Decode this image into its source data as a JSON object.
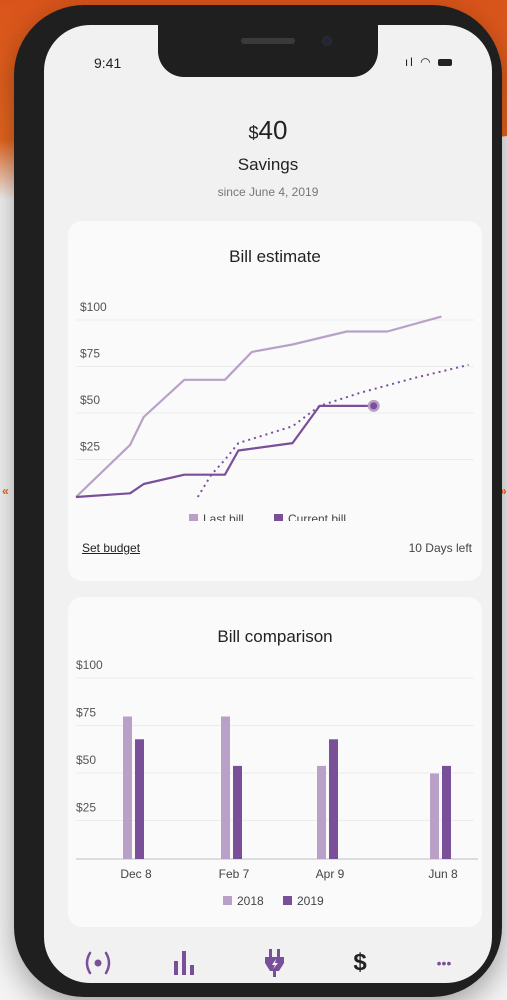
{
  "status": {
    "time": "9:41"
  },
  "summary": {
    "currency": "$",
    "amount": "40",
    "label": "Savings",
    "since": "since June 4, 2019"
  },
  "bill_estimate": {
    "title": "Bill estimate",
    "legend": [
      "Last bill",
      "Current bill"
    ],
    "set_budget": "Set budget",
    "days_left": "10 Days left"
  },
  "bill_comparison": {
    "title": "Bill comparison",
    "legend": [
      "2018",
      "2019"
    ]
  },
  "colors": {
    "light": "#b9a0c9",
    "dark": "#7a4f99",
    "accent": "#e5661f"
  },
  "tabs": [
    {
      "icon": "live-icon"
    },
    {
      "icon": "usage-bars-icon"
    },
    {
      "icon": "plug-icon"
    },
    {
      "icon": "dollar-icon",
      "label": "$"
    },
    {
      "icon": "more-icon",
      "label": "•••"
    }
  ],
  "chart_data": [
    {
      "type": "line",
      "title": "Bill estimate",
      "y_ticks": [
        "$100",
        "$75",
        "$50",
        "$25"
      ],
      "ylim": [
        0,
        100
      ],
      "x": [
        0,
        1,
        2,
        3,
        4,
        5,
        6,
        7,
        8,
        9,
        10,
        11,
        12,
        13,
        14,
        15,
        16,
        17,
        18,
        19,
        20,
        21,
        22,
        23,
        24,
        25,
        26,
        27,
        28,
        29,
        30
      ],
      "series": [
        {
          "name": "Last bill",
          "style": "solid",
          "points": [
            [
              0,
              0
            ],
            [
              4,
              28
            ],
            [
              5,
              43
            ],
            [
              8,
              63
            ],
            [
              11,
              63
            ],
            [
              13,
              78
            ],
            [
              16,
              82
            ],
            [
              20,
              89
            ],
            [
              23,
              89
            ],
            [
              27,
              97
            ]
          ]
        },
        {
          "name": "Current bill",
          "style": "solid",
          "points": [
            [
              0,
              0
            ],
            [
              4,
              2
            ],
            [
              5,
              7
            ],
            [
              8,
              12
            ],
            [
              11,
              12
            ],
            [
              12,
              25
            ],
            [
              16,
              29
            ],
            [
              18,
              49
            ],
            [
              22,
              49
            ]
          ]
        },
        {
          "name": "Projection",
          "style": "dotted",
          "points": [
            [
              9,
              0
            ],
            [
              10,
              12
            ],
            [
              11,
              20
            ],
            [
              12,
              29
            ],
            [
              16,
              38
            ],
            [
              18,
              49
            ],
            [
              21,
              56
            ],
            [
              25,
              64
            ],
            [
              29,
              71
            ]
          ]
        }
      ],
      "legend_position": "bottom"
    },
    {
      "type": "bar",
      "title": "Bill comparison",
      "categories": [
        "Dec 8",
        "Feb 7",
        "Apr 9",
        "Jun 8"
      ],
      "y_ticks": [
        "$100",
        "$75",
        "$50",
        "$25"
      ],
      "ylim": [
        0,
        100
      ],
      "series": [
        {
          "name": "2018",
          "values": [
            75,
            75,
            49,
            45
          ]
        },
        {
          "name": "2019",
          "values": [
            63,
            49,
            63,
            49
          ]
        }
      ],
      "legend_position": "bottom"
    }
  ]
}
